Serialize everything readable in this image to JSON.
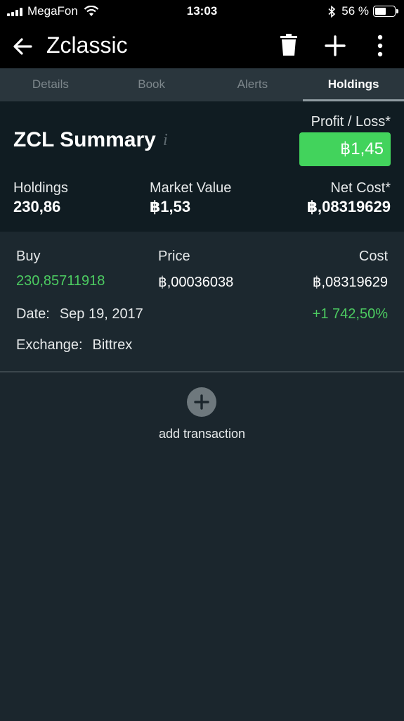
{
  "status_bar": {
    "carrier": "MegaFon",
    "time": "13:03",
    "battery_percent": "56 %",
    "battery_level": 0.56
  },
  "app_bar": {
    "title": "Zclassic"
  },
  "tabs": [
    {
      "label": "Details",
      "active": false
    },
    {
      "label": "Book",
      "active": false
    },
    {
      "label": "Alerts",
      "active": false
    },
    {
      "label": "Holdings",
      "active": true
    }
  ],
  "summary": {
    "title": "ZCL Summary",
    "info_glyph": "i",
    "profit_loss_label": "Profit / Loss*",
    "profit_loss_value": "฿1,45",
    "holdings_label": "Holdings",
    "holdings_value": "230,86",
    "market_value_label": "Market Value",
    "market_value_value": "฿1,53",
    "net_cost_label": "Net Cost*",
    "net_cost_value": "฿,08319629"
  },
  "transaction": {
    "buy_label": "Buy",
    "buy_value": "230,85711918",
    "price_label": "Price",
    "price_value": "฿,00036038",
    "cost_label": "Cost",
    "cost_value": "฿,08319629",
    "date_label": "Date:",
    "date_value": "Sep 19, 2017",
    "change_percent": "+1 742,50%",
    "exchange_label": "Exchange:",
    "exchange_value": "Bittrex"
  },
  "add_transaction": {
    "label": "add transaction"
  },
  "colors": {
    "profit_green": "#42d35c",
    "positive_text": "#4ccb61",
    "background": "#1b262d",
    "tab_bar": "#2a363d"
  }
}
